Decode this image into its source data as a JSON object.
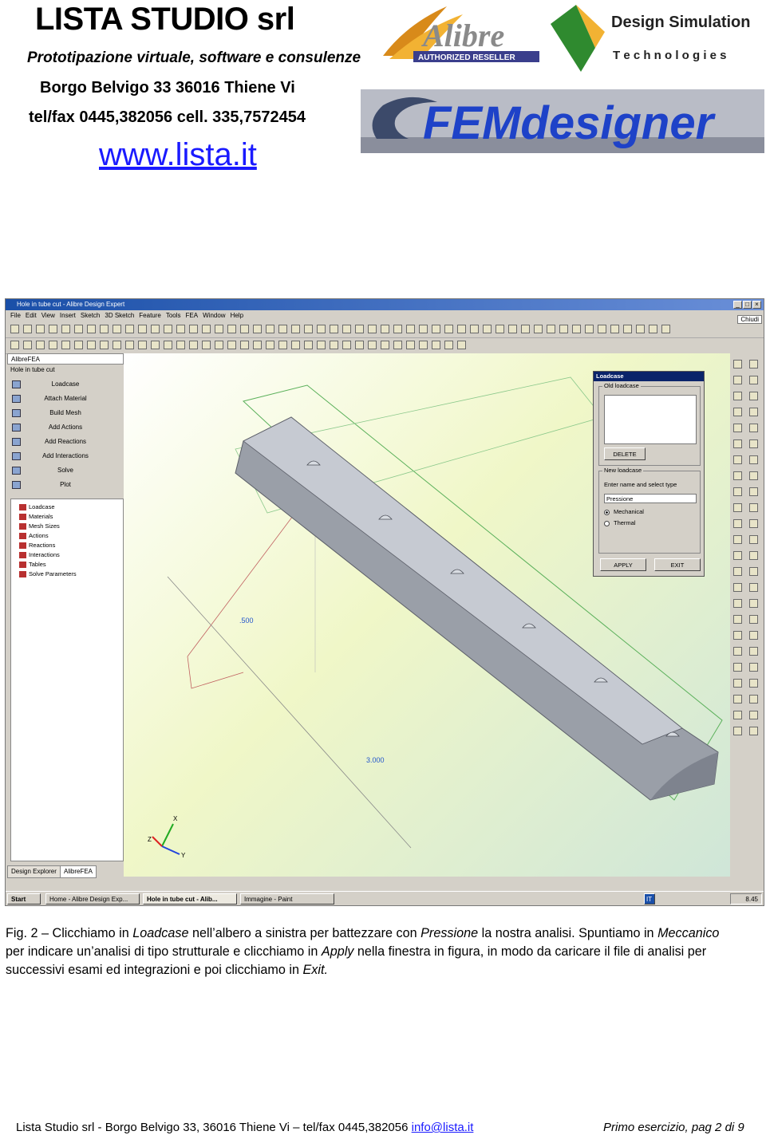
{
  "header": {
    "company": "LISTA STUDIO srl",
    "tagline": "Prototipazione virtuale, software e consulenze",
    "address": "Borgo Belvigo 33   36016 Thiene Vi",
    "phone": "tel/fax 0445,382056  cell. 335,7572454",
    "website": "www.lista.it"
  },
  "logos": {
    "alibre_name": "Alibre",
    "alibre_badge": "AUTHORIZED RESELLER",
    "dst_line1": "Design Simulation",
    "dst_line2": "T e c h n o l o g i e s",
    "femdesigner": "FEMdesigner"
  },
  "app": {
    "window_title": "Hole in tube cut - Alibre Design Expert",
    "menu": [
      "File",
      "Edit",
      "View",
      "Insert",
      "Sketch",
      "3D Sketch",
      "Feature",
      "Tools",
      "FEA",
      "Window",
      "Help"
    ],
    "chiudi_label": "Chiudi",
    "left_panel": {
      "header": "AlibreFEA",
      "part_name": "Hole in tube cut",
      "items": [
        "Loadcase",
        "Attach Material",
        "Build Mesh",
        "Add Actions",
        "Add Reactions",
        "Add Interactions",
        "Solve",
        "Plot"
      ],
      "tree": [
        "Loadcase",
        "Materials",
        "Mesh Sizes",
        "Actions",
        "Reactions",
        "Interactions",
        "Tables",
        "Solve Parameters"
      ],
      "tabs": [
        "Design Explorer",
        "AlibreFEA"
      ]
    },
    "viewport": {
      "dim_1": ".500",
      "dim_2": "3.000",
      "axis_x": "X",
      "axis_y": "Y",
      "axis_z": "Z"
    },
    "dialog": {
      "title": "Loadcase",
      "old_group": "Old loadcase",
      "delete_button": "DELETE",
      "new_group": "New loadcase",
      "prompt": "Enter name and select type",
      "name_value": "Pressione",
      "type_options": [
        "Mechanical",
        "Thermal"
      ],
      "selected_type": "Mechanical",
      "apply_button": "APPLY",
      "exit_button": "EXIT"
    },
    "taskbar": {
      "start": "Start",
      "tasks": [
        "Home - Alibre Design Exp...",
        "Hole in tube cut - Alib...",
        "Immagine - Paint"
      ],
      "language": "IT",
      "clock": "8.45"
    }
  },
  "caption": {
    "fig_label": "Fig. 2",
    "t1": " – Clicchiamo in ",
    "e1": "Loadcase",
    "t2": " nell’albero a sinistra per battezzare con ",
    "e2": "Pressione",
    "t3": " la nostra analisi. Spuntiamo in ",
    "e3": "Meccanico",
    "t4": " per indicare un’analisi di tipo strutturale e clicchiamo in ",
    "e4": "Apply",
    "t5": " nella finestra in figura, in modo da caricare il file di analisi per successivi esami ed integrazioni e poi clicchiamo in ",
    "e5": "Exit."
  },
  "footer": {
    "left": "Lista Studio srl - Borgo Belvigo 33, 36016 Thiene Vi – tel/fax 0445,382056  ",
    "email": "info@lista.it",
    "right": "Primo esercizio, pag  2 di 9"
  },
  "colors": {
    "link": "#1a1aff",
    "titlebar": "#1a4fa8",
    "dialog_title": "#0a246a",
    "part_grey": "#9a9fa8"
  }
}
